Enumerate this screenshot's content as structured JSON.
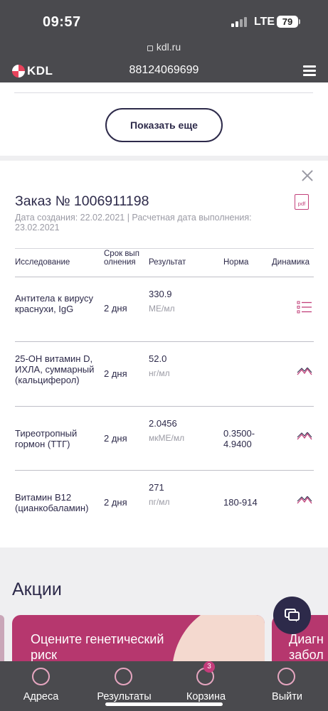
{
  "status_bar": {
    "time": "09:57",
    "network": "LTE",
    "battery": "79"
  },
  "browser": {
    "url": "kdl.ru"
  },
  "header": {
    "logo_text": "KDL",
    "phone": "88124069699"
  },
  "show_more_label": "Показать еще",
  "order": {
    "title": "Заказ № 1006911198",
    "meta": "Дата создания: 22.02.2021 | Расчетная дата выполнения: 23.02.2021",
    "pdf_label": "pdf",
    "columns": {
      "study": "Исследование",
      "term": "Срок выполнения",
      "result": "Результат",
      "norm": "Норма",
      "dynamics": "Динамика"
    },
    "rows": [
      {
        "study": "Антитела к вирусу краснухи, IgG",
        "term": "2 дня",
        "value": "330.9",
        "unit": "МЕ/мл",
        "norm": "",
        "dynamics_icon": "list-icon"
      },
      {
        "study": "25-OH витамин D, ИХЛА, суммарный (кальциферол)",
        "term": "2 дня",
        "value": "52.0",
        "unit": "нг/мл",
        "norm": "",
        "dynamics_icon": "chart-icon"
      },
      {
        "study": "Тиреотропный гормон (ТТГ)",
        "term": "2 дня",
        "value": "2.0456",
        "unit": "мкМЕ/мл",
        "norm": "0.3500-4.9400",
        "dynamics_icon": "chart-icon"
      },
      {
        "study": "Витамин B12 (цианкобаламин)",
        "term": "2 дня",
        "value": "271",
        "unit": "пг/мл",
        "norm": "180-914",
        "dynamics_icon": "chart-icon"
      }
    ]
  },
  "promo": {
    "title": "Акции",
    "card1_text": "Оцените генетический риск",
    "card2_text": "Диагн забол"
  },
  "bottom_nav": {
    "items": [
      {
        "label": "Адреса",
        "icon": "location-icon"
      },
      {
        "label": "Результаты",
        "icon": "results-icon"
      },
      {
        "label": "Корзина",
        "icon": "cart-icon"
      },
      {
        "label": "Выйти",
        "icon": "user-icon"
      }
    ],
    "cart_badge": "3"
  },
  "colors": {
    "dark_bar": "#4a4a4e",
    "brand_dark": "#2d2a4a",
    "accent_pink": "#c2407a",
    "muted_text": "#9b9ba5"
  }
}
